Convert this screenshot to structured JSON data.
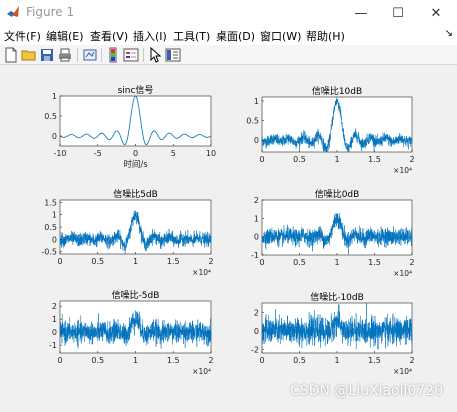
{
  "window": {
    "title": "Figure 1"
  },
  "menu": [
    "文件(F)",
    "编辑(E)",
    "查看(V)",
    "插入(I)",
    "工具(T)",
    "桌面(D)",
    "窗口(W)",
    "帮助(H)"
  ],
  "toolbar_icons": [
    "new-figure-icon",
    "open-folder-icon",
    "save-icon",
    "print-icon",
    "link-plot-icon",
    "insert-colorbar-icon",
    "insert-legend-icon",
    "pointer-icon",
    "property-inspector-icon"
  ],
  "watermark": "CSDN @LiuXiaoli0720",
  "chart_data": [
    {
      "type": "line",
      "title": "sinc信号",
      "xlabel": "时间/s",
      "ylabel": "",
      "xlim": [
        -10,
        10
      ],
      "ylim": [
        -0.25,
        1
      ],
      "xticks": [
        "-10",
        "-5",
        "0",
        "5",
        "10"
      ],
      "yticks": [
        "0",
        "0.5",
        "1"
      ],
      "signal": "sinc",
      "color": "#0072bd",
      "exponent": ""
    },
    {
      "type": "line",
      "title": "信噪比10dB",
      "xlabel": "",
      "ylabel": "",
      "xlim": [
        0,
        20000
      ],
      "ylim": [
        -0.3,
        1.1
      ],
      "xticks": [
        "0",
        "0.5",
        "1",
        "1.5",
        "2"
      ],
      "yticks": [
        "0",
        "0.5",
        "1"
      ],
      "noise_std": 0.07,
      "color": "#0072bd",
      "exponent": "×10⁴"
    },
    {
      "type": "line",
      "title": "信噪比5dB",
      "xlabel": "",
      "ylabel": "",
      "xlim": [
        0,
        20000
      ],
      "ylim": [
        -0.6,
        1.6
      ],
      "xticks": [
        "0",
        "0.5",
        "1",
        "1.5",
        "2"
      ],
      "yticks": [
        "-0.5",
        "0",
        "0.5",
        "1",
        "1.5"
      ],
      "noise_std": 0.13,
      "color": "#0072bd",
      "exponent": "×10⁴"
    },
    {
      "type": "line",
      "title": "信噪比0dB",
      "xlabel": "",
      "ylabel": "",
      "xlim": [
        0,
        20000
      ],
      "ylim": [
        -1,
        2
      ],
      "xticks": [
        "0",
        "0.5",
        "1",
        "1.5",
        "2"
      ],
      "yticks": [
        "-1",
        "0",
        "1",
        "2"
      ],
      "noise_std": 0.22,
      "color": "#0072bd",
      "exponent": "×10⁴"
    },
    {
      "type": "line",
      "title": "信噪比-5dB",
      "xlabel": "",
      "ylabel": "",
      "xlim": [
        0,
        20000
      ],
      "ylim": [
        -1.6,
        2.4
      ],
      "xticks": [
        "0",
        "0.5",
        "1",
        "1.5",
        "2"
      ],
      "yticks": [
        "-1",
        "0",
        "1",
        "2"
      ],
      "noise_std": 0.4,
      "color": "#0072bd",
      "exponent": "×10⁴"
    },
    {
      "type": "line",
      "title": "信噪比-10dB",
      "xlabel": "",
      "ylabel": "",
      "xlim": [
        0,
        20000
      ],
      "ylim": [
        -2.4,
        3
      ],
      "xticks": [
        "0",
        "0.5",
        "1",
        "1.5",
        "2"
      ],
      "yticks": [
        "-2",
        "0",
        "2"
      ],
      "noise_std": 0.7,
      "color": "#0072bd",
      "exponent": "×10⁴"
    }
  ]
}
